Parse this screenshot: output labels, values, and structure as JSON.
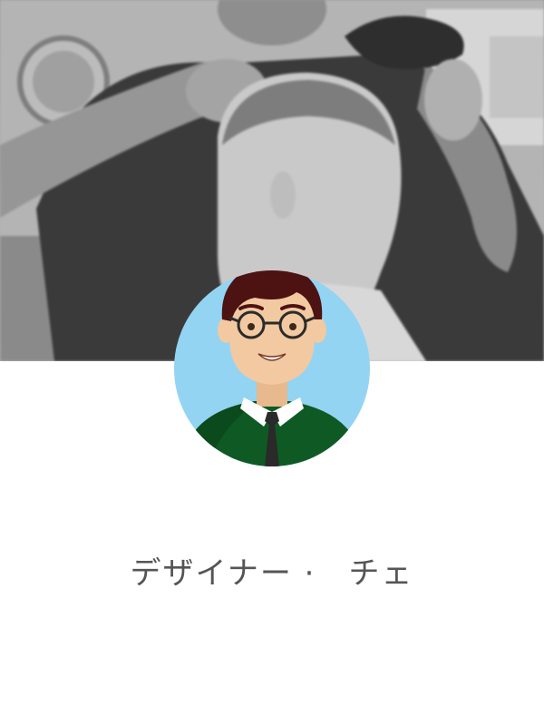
{
  "profile": {
    "name": "デザイナー ·　チェ"
  },
  "cover": {
    "icon": "cover-photo-barber"
  },
  "avatar": {
    "icon": "avatar-man-glasses",
    "colors": {
      "background": "#93d4f3",
      "hair": "#4d1212",
      "skin": "#f2c9a1",
      "sweater": "#0f5a24",
      "tie": "#2a2a2a"
    }
  }
}
